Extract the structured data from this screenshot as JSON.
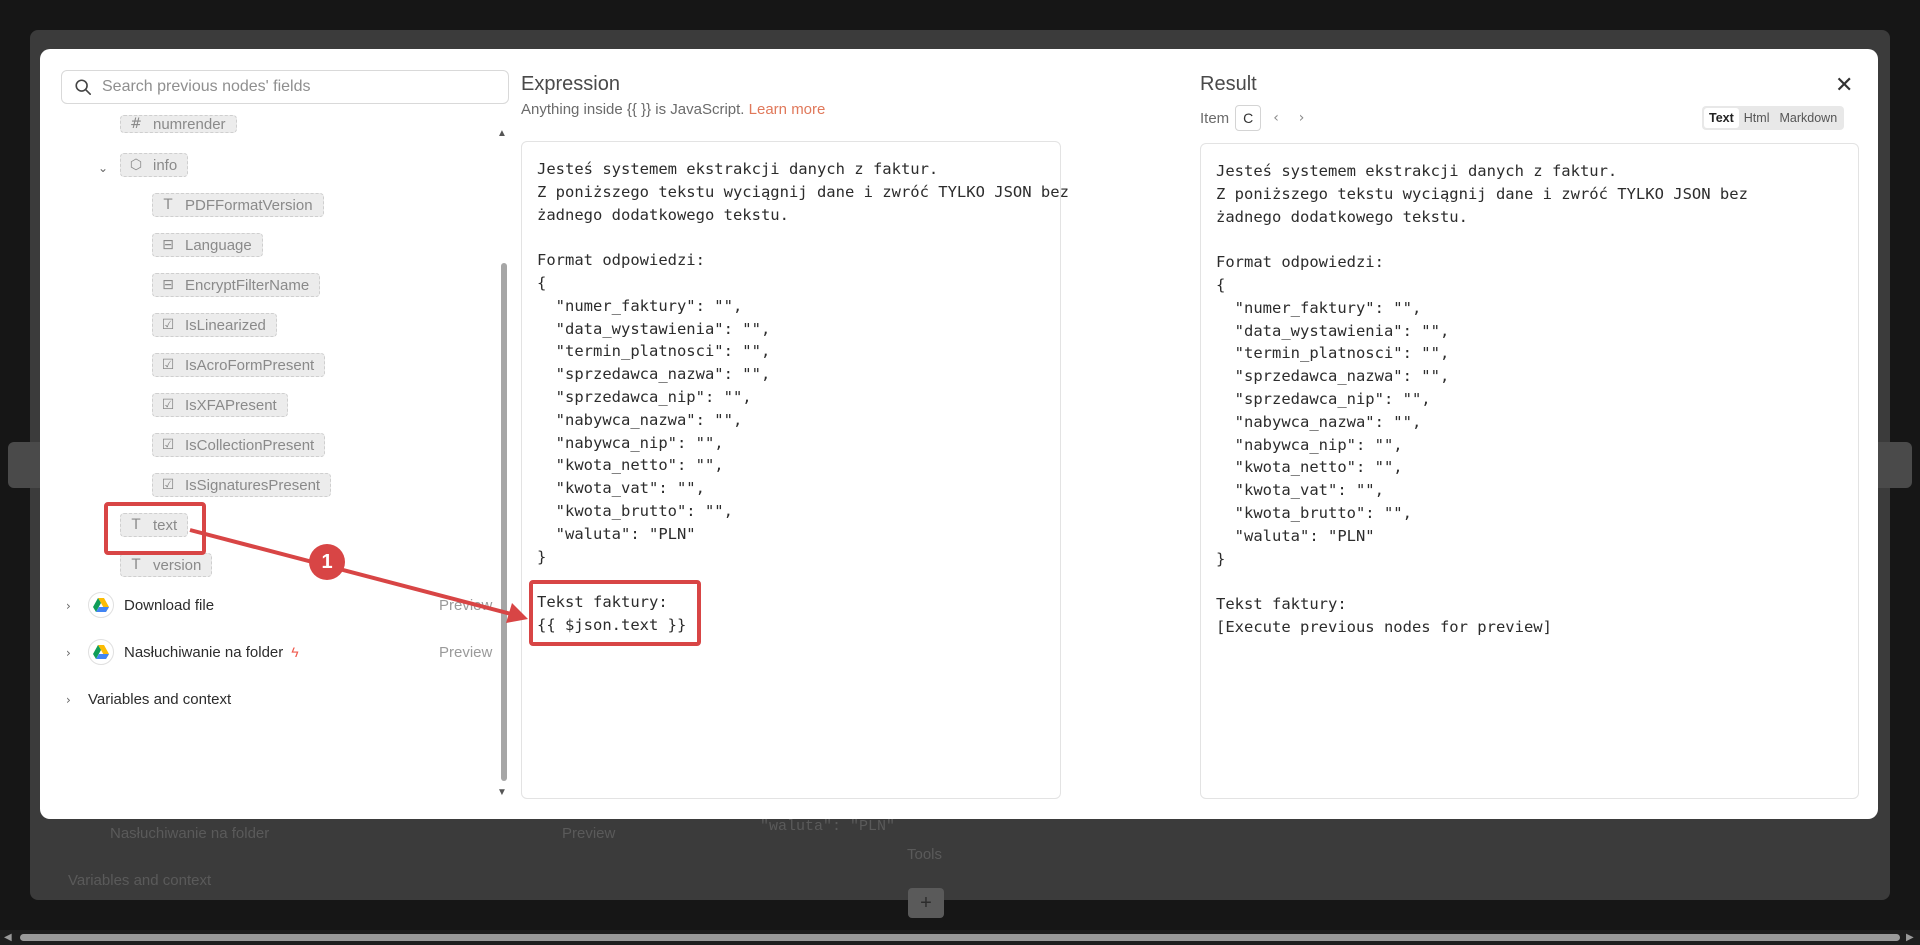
{
  "search": {
    "placeholder": "Search previous nodes' fields"
  },
  "tree": {
    "partial_top": "numrender",
    "info_label": "info",
    "info_fields": [
      {
        "label": "PDFFormatVersion",
        "icon": "text-type-icon"
      },
      {
        "label": "Language",
        "icon": "object-type-icon"
      },
      {
        "label": "EncryptFilterName",
        "icon": "object-type-icon"
      },
      {
        "label": "IsLinearized",
        "icon": "boolean-type-icon"
      },
      {
        "label": "IsAcroFormPresent",
        "icon": "boolean-type-icon"
      },
      {
        "label": "IsXFAPresent",
        "icon": "boolean-type-icon"
      },
      {
        "label": "IsCollectionPresent",
        "icon": "boolean-type-icon"
      },
      {
        "label": "IsSignaturesPresent",
        "icon": "boolean-type-icon"
      }
    ],
    "text_label": "text",
    "version_label": "version",
    "nodes": [
      {
        "label": "Download file",
        "preview": "Preview"
      },
      {
        "label": "Nasłuchiwanie na folder",
        "preview": "Preview"
      }
    ],
    "variables_label": "Variables and context"
  },
  "expression": {
    "title": "Expression",
    "subtitle_prefix": "Anything inside {{ }} is JavaScript.",
    "learn_more": "Learn more",
    "body": "Jesteś systemem ekstrakcji danych z faktur.\nZ poniższego tekstu wyciągnij dane i zwróć TYLKO JSON bez\nżadnego dodatkowego tekstu.\n\nFormat odpowiedzi:\n{\n  \"numer_faktury\": \"\",\n  \"data_wystawienia\": \"\",\n  \"termin_platnosci\": \"\",\n  \"sprzedawca_nazwa\": \"\",\n  \"sprzedawca_nip\": \"\",\n  \"nabywca_nazwa\": \"\",\n  \"nabywca_nip\": \"\",\n  \"kwota_netto\": \"\",\n  \"kwota_vat\": \"\",\n  \"kwota_brutto\": \"\",\n  \"waluta\": \"PLN\"\n}\n\nTekst faktury:\n{{ $json.text }}"
  },
  "result": {
    "title": "Result",
    "item_label": "Item",
    "item_value": "C",
    "tabs": [
      "Text",
      "Html",
      "Markdown"
    ],
    "body": "Jesteś systemem ekstrakcji danych z faktur.\nZ poniższego tekstu wyciągnij dane i zwróć TYLKO JSON bez\nżadnego dodatkowego tekstu.\n\nFormat odpowiedzi:\n{\n  \"numer_faktury\": \"\",\n  \"data_wystawienia\": \"\",\n  \"termin_platnosci\": \"\",\n  \"sprzedawca_nazwa\": \"\",\n  \"sprzedawca_nip\": \"\",\n  \"nabywca_nazwa\": \"\",\n  \"nabywca_nip\": \"\",\n  \"kwota_netto\": \"\",\n  \"kwota_vat\": \"\",\n  \"kwota_brutto\": \"\",\n  \"waluta\": \"PLN\"\n}\n\nTekst faktury:\n[Execute previous nodes for preview]"
  },
  "background": {
    "node_label": "Nasłuchiwanie na folder",
    "preview": "Preview",
    "variables": "Variables and context",
    "code_line": "\"waluta\": \"PLN\"",
    "tools": "Tools",
    "plus": "+"
  },
  "annotation": {
    "badge": "1",
    "color": "#d84545"
  },
  "colors": {
    "accent_link": "#e0785a",
    "bolt": "#ef5a4e"
  }
}
